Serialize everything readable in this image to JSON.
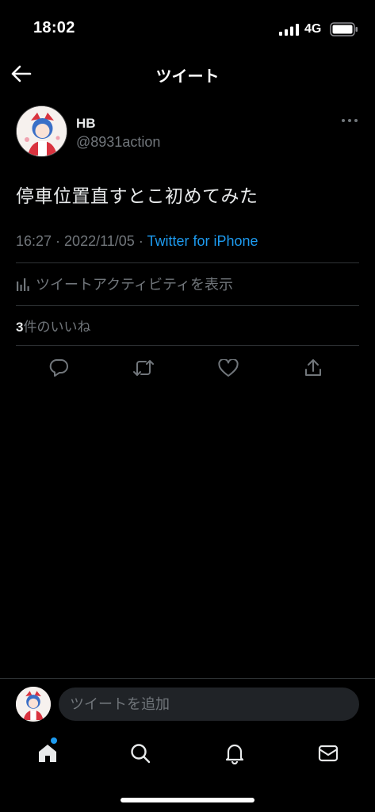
{
  "status_bar": {
    "time": "18:02",
    "network": "4G"
  },
  "nav": {
    "title": "ツイート"
  },
  "tweet": {
    "display_name": "HB",
    "handle": "@8931action",
    "text": "停車位置直すとこ初めてみた",
    "time": "16:27",
    "date": "2022/11/05",
    "source": "Twitter for iPhone",
    "activity_label": "ツイートアクティビティを表示",
    "likes_count": "3",
    "likes_label": "件のいいね"
  },
  "reply": {
    "placeholder": "ツイートを追加"
  },
  "colors": {
    "accent": "#1d9bf0",
    "background": "#000000",
    "secondary_text": "#71767b",
    "divider": "#2f3336"
  },
  "icons": {
    "back": "arrow-left-icon",
    "more": "more-icon",
    "activity": "bar-chart-icon",
    "reply": "reply-icon",
    "retweet": "retweet-icon",
    "like": "heart-icon",
    "share": "share-icon",
    "home": "home-icon",
    "search": "search-icon",
    "notifications": "bell-icon",
    "messages": "mail-icon"
  }
}
